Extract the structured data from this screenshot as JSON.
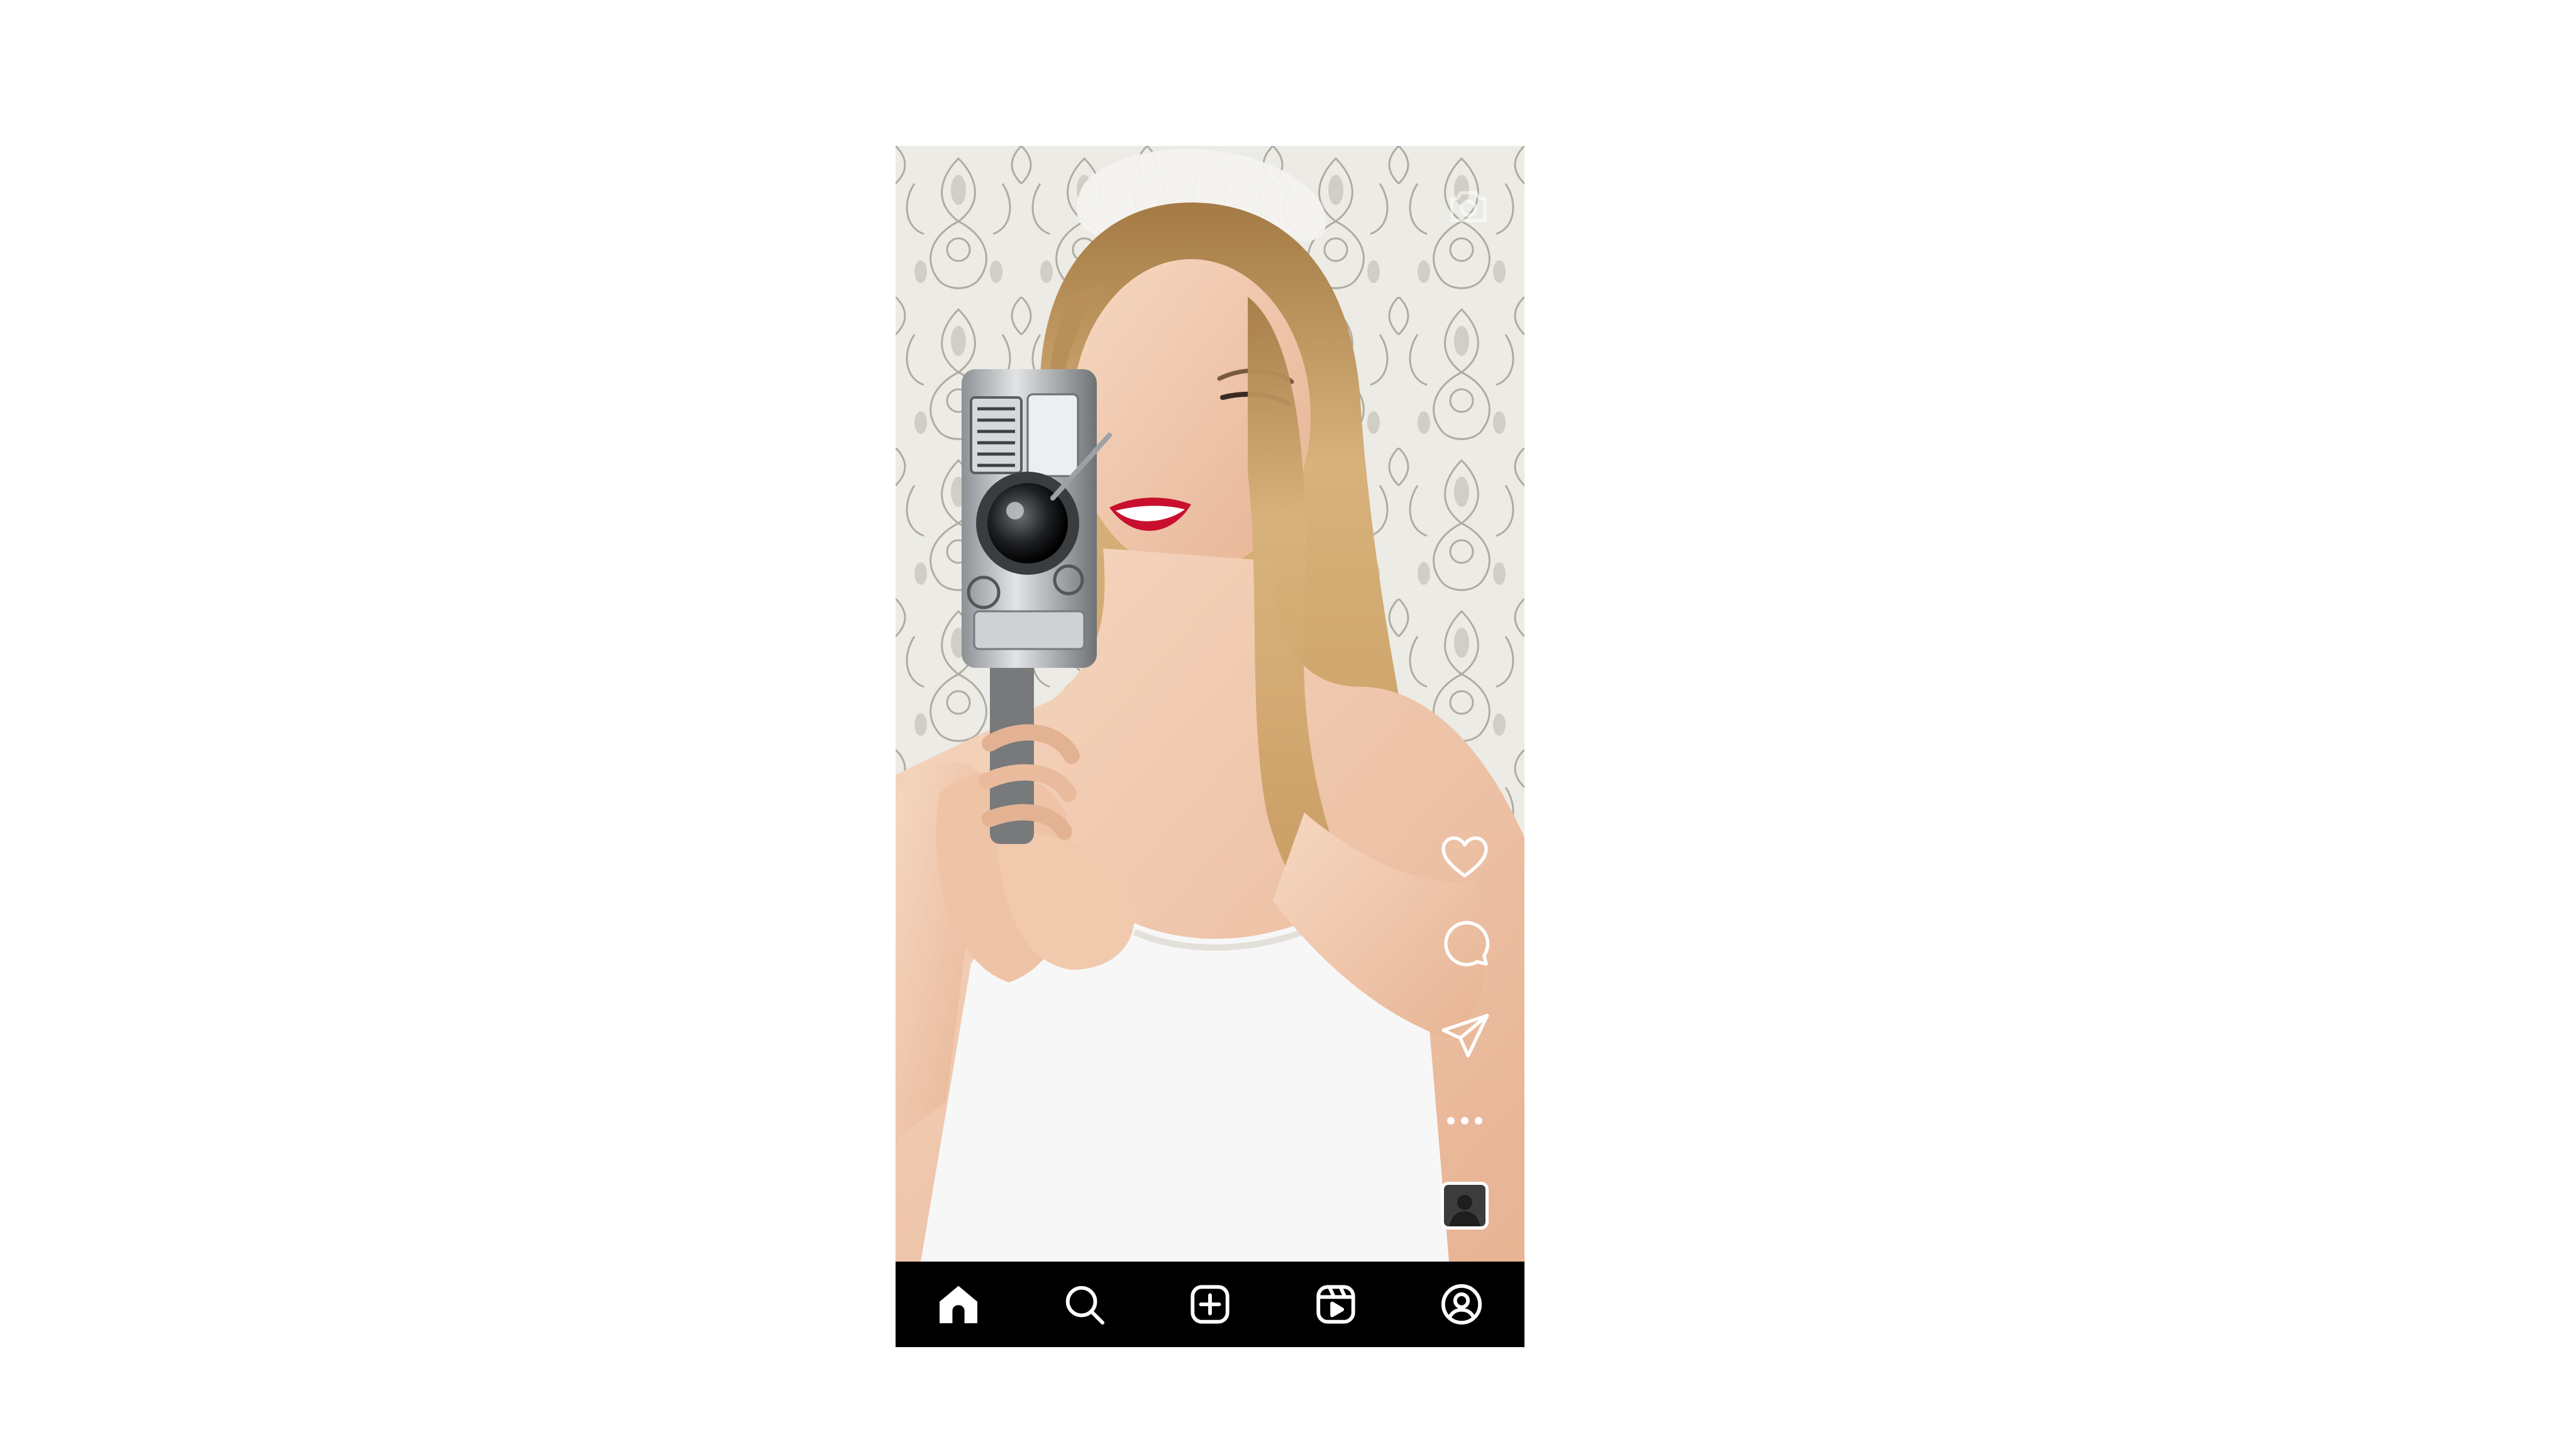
{
  "app": {
    "screen": "reels-viewer"
  },
  "colors": {
    "nav_background": "#000000",
    "icon_color": "#ffffff",
    "lipstick": "#c8102e",
    "hair": "#c8a165",
    "wallpaper_base": "#e9e7e0",
    "wallpaper_pattern": "#8d8a7e"
  },
  "top": {
    "camera_icon": "camera-icon"
  },
  "actions": {
    "like_icon": "heart-icon",
    "comment_icon": "comment-icon",
    "share_icon": "send-icon",
    "more_icon": "more-dots-icon",
    "audio_icon": "audio-thumbnail"
  },
  "nav": {
    "items": [
      {
        "icon": "home-icon",
        "active": true
      },
      {
        "icon": "search-icon",
        "active": false
      },
      {
        "icon": "create-post-icon",
        "active": false
      },
      {
        "icon": "reels-icon",
        "active": false
      },
      {
        "icon": "profile-icon",
        "active": false
      }
    ]
  }
}
